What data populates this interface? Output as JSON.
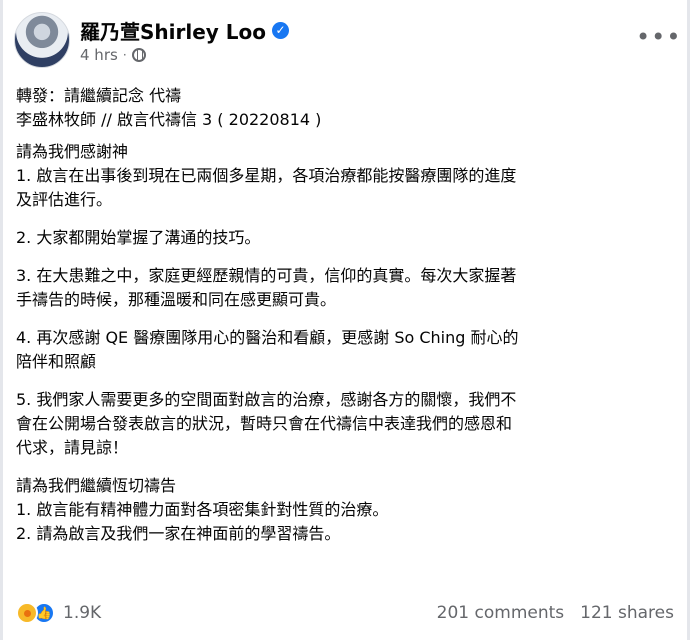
{
  "post": {
    "author": "羅乃萱Shirley Loo",
    "time": "4 hrs",
    "dot": "·",
    "content_lines": [
      "轉發：請繼續記念 代禱",
      "李盛林牧師 // 啟言代禱信 3 ( 20220814 )",
      "請為我們感謝神",
      "1. 啟言在出事後到現在已兩個多星期，各項治療都能按醫療團隊的進度",
      "及評估進行。",
      "2. 大家都開始掌握了溝通的技巧。",
      "3. 在大患難之中，家庭更經歷親情的可貴，信仰的真實。每次大家握著",
      "手禱告的時候，那種溫暖和同在感更顯可貴。",
      "4. 再次感謝 QE 醫療團隊用心的醫治和看顧，更感謝 So Ching 耐心的",
      "陪伴和照顧",
      "5. 我們家人需要更多的空間面對啟言的治療，感謝各方的關懷，我們不",
      "會在公開場合發表啟言的狀況，暫時只會在代禱信中表達我們的感恩和",
      "代求，請見諒！",
      "請為我們繼續恆切禱告",
      "1. 啟言能有精神體力面對各項密集針對性質的治療。",
      "2. 請為啟言及我們一家在神面前的學習禱告。"
    ],
    "reaction_count": "1.9K",
    "comments": "201 comments",
    "shares": "121 shares",
    "more_label": "•••",
    "verified_mark": "✓",
    "like_mark": "👍"
  },
  "colors": {
    "verified": "#1877f2",
    "secondary_text": "#65676b",
    "care_reaction": "#f7b928",
    "like_reaction": "#1877f2"
  },
  "icons": [
    "avatar",
    "verified-icon",
    "globe-icon",
    "more-icon",
    "care-reaction-icon",
    "like-reaction-icon"
  ]
}
